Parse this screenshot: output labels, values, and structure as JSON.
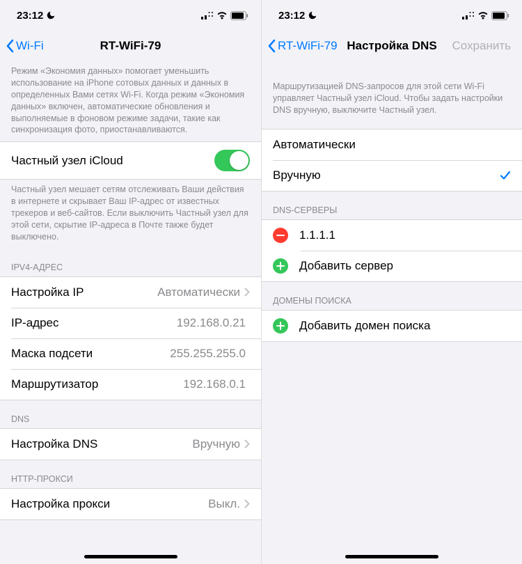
{
  "status": {
    "time": "23:12"
  },
  "left": {
    "nav": {
      "back": "Wi-Fi",
      "title": "RT-WiFi-79"
    },
    "data_mode_desc": "Режим «Экономия данных» помогает уменьшить использование на iPhone сотовых данных и данных в определенных Вами сетях Wi-Fi. Когда режим «Экономия данных» включен, автоматические обновления и выполняемые в фоновом режиме задачи, такие как синхронизация фото, приостанавливаются.",
    "private_relay": {
      "label": "Частный узел iCloud"
    },
    "private_relay_desc": "Частный узел мешает сетям отслеживать Ваши действия в интернете и скрывает Ваш IP-адрес от известных трекеров и веб-сайтов. Если выключить Частный узел для этой сети, скрытие IP-адреса в Почте также будет выключено.",
    "ipv4_header": "IPV4-АДРЕС",
    "ipv4": {
      "configure_label": "Настройка IP",
      "configure_value": "Автоматически",
      "ip_label": "IP-адрес",
      "ip_value": "192.168.0.21",
      "mask_label": "Маска подсети",
      "mask_value": "255.255.255.0",
      "router_label": "Маршрутизатор",
      "router_value": "192.168.0.1"
    },
    "dns_header": "DNS",
    "dns": {
      "label": "Настройка DNS",
      "value": "Вручную"
    },
    "proxy_header": "HTTP-ПРОКСИ",
    "proxy": {
      "label": "Настройка прокси",
      "value": "Выкл."
    }
  },
  "right": {
    "nav": {
      "back": "RT-WiFi-79",
      "title": "Настройка DNS",
      "action": "Сохранить"
    },
    "desc": "Маршрутизацией DNS-запросов для этой сети Wi-Fi управляет Частный узел iCloud. Чтобы задать настройки DNS вручную, выключите Частный узел.",
    "mode": {
      "auto": "Автоматически",
      "manual": "Вручную"
    },
    "servers_header": "DNS-СЕРВЕРЫ",
    "servers": {
      "item0": "1.1.1.1",
      "add": "Добавить сервер"
    },
    "domains_header": "ДОМЕНЫ ПОИСКА",
    "domains": {
      "add": "Добавить домен поиска"
    }
  }
}
